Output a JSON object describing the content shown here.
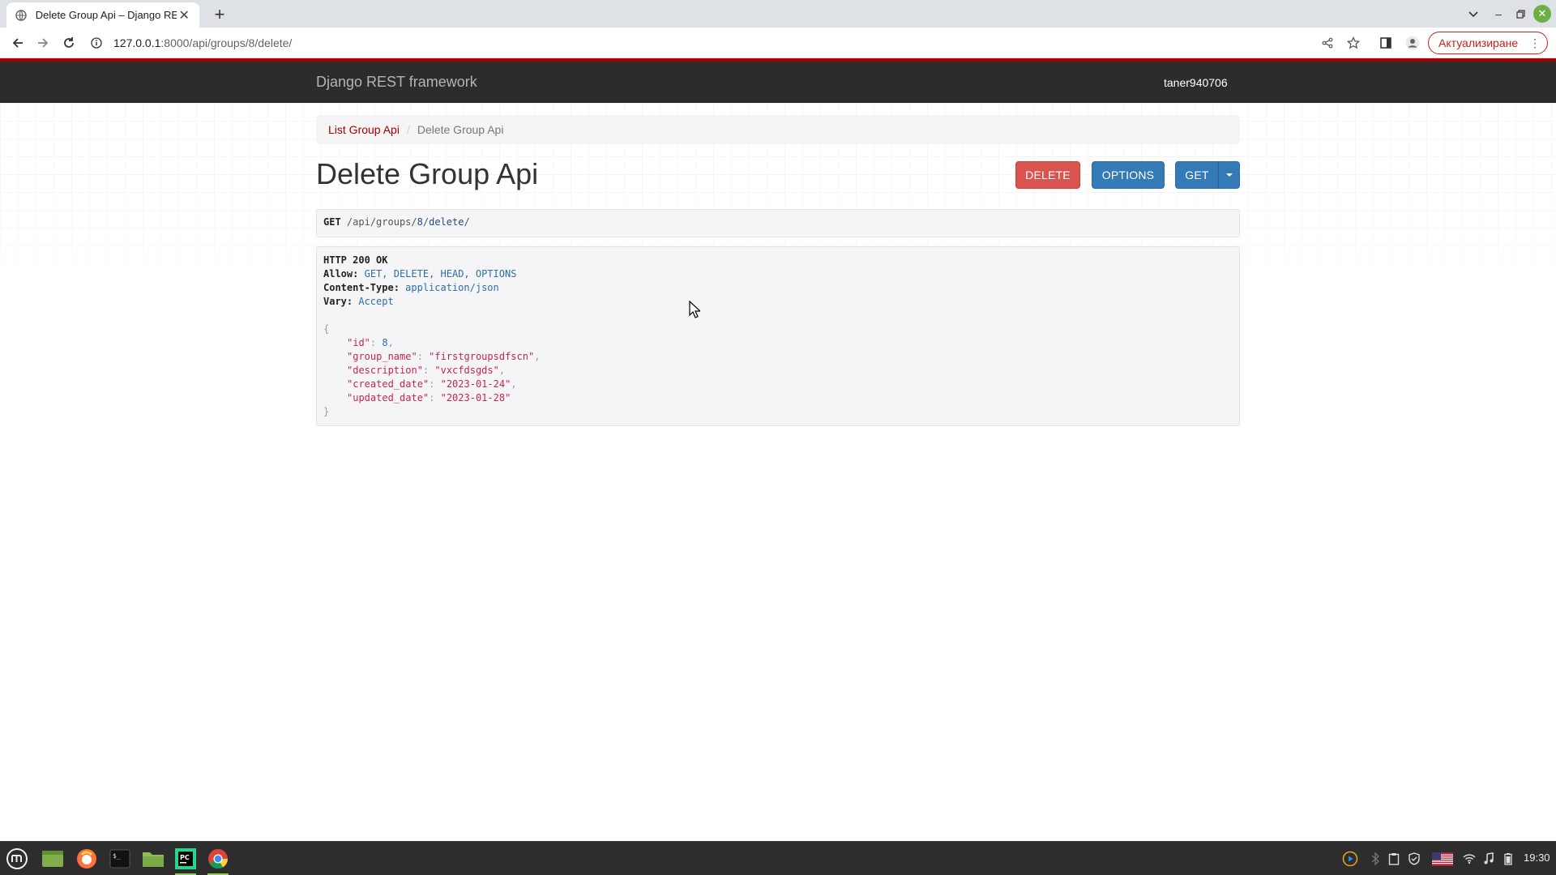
{
  "browser": {
    "tab_title": "Delete Group Api – Django RE",
    "url_host": "127.0.0.1",
    "url_path": ":8000/api/groups/8/delete/",
    "update_button_label": "Актуализиране"
  },
  "navbar": {
    "brand": "Django REST framework",
    "username": "taner940706"
  },
  "breadcrumb": {
    "link_label": "List Group Api",
    "separator": "/",
    "active_label": "Delete Group Api"
  },
  "page": {
    "title": "Delete Group Api",
    "buttons": {
      "delete": "DELETE",
      "options": "OPTIONS",
      "get": "GET"
    }
  },
  "request": {
    "method": "GET",
    "path_1": "/api/groups/",
    "path_id": "8",
    "path_2": "/",
    "path_kw": "delete",
    "path_3": "/"
  },
  "response": {
    "status": "HTTP 200 OK",
    "headers": [
      {
        "name": "Allow:",
        "value": "GET, DELETE, HEAD, OPTIONS"
      },
      {
        "name": "Content-Type:",
        "value": "application/json"
      },
      {
        "name": "Vary:",
        "value": "Accept"
      }
    ],
    "open_brace": "{",
    "close_brace": "}",
    "fields": [
      {
        "key": "\"id\"",
        "value": "8",
        "type": "num"
      },
      {
        "key": "\"group_name\"",
        "value": "\"firstgroupsdfscn\"",
        "type": "str"
      },
      {
        "key": "\"description\"",
        "value": "\"vxcfdsgds\"",
        "type": "str"
      },
      {
        "key": "\"created_date\"",
        "value": "\"2023-01-24\"",
        "type": "str"
      },
      {
        "key": "\"updated_date\"",
        "value": "\"2023-01-28\"",
        "type": "str"
      }
    ]
  },
  "taskbar": {
    "clock": "19:30"
  },
  "colors": {
    "accent_red": "#a30000",
    "delete_button": "#d9534f",
    "primary_button": "#337ab7",
    "navbar_bg": "#2c2c2c"
  }
}
